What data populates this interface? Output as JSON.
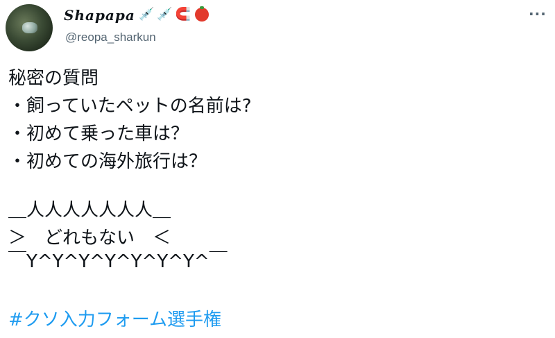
{
  "tweet": {
    "display_name": "Shapapa",
    "handle": "@reopa_sharkun",
    "more_label": "···",
    "emojis": [
      "syringe-icon",
      "syringe-icon",
      "magnet-icon",
      "tomato-icon"
    ],
    "lines": [
      "秘密の質問",
      "・飼っていたペットの名前は?",
      "・初めて乗った車は？",
      "・初めての海外旅行は？",
      "＿人人人人人人人＿",
      "＞　どれもない　＜",
      "￣Y^Y^Y^Y^Y^Y^Y^￣"
    ],
    "hashtag": "#クソ入力フォーム選手権"
  }
}
